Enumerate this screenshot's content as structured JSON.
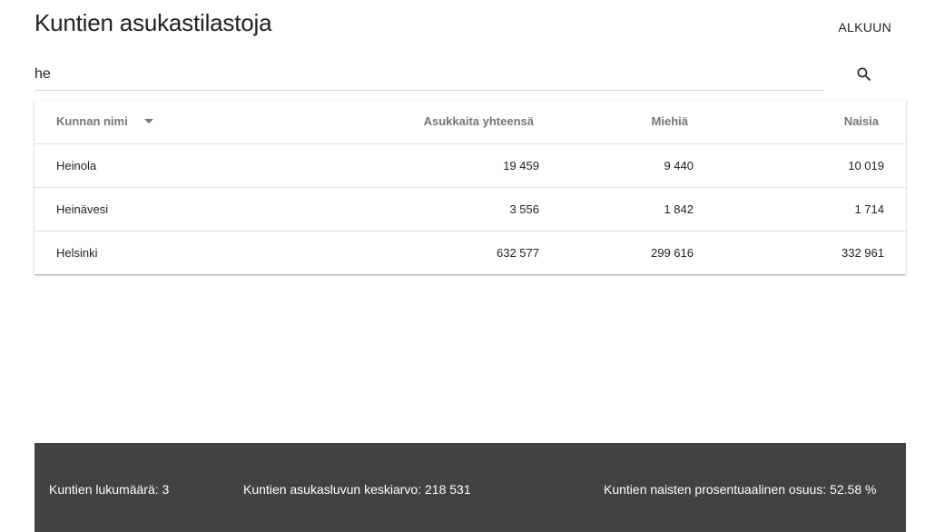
{
  "header": {
    "title": "Kuntien asukastilastoja",
    "home_label": "ALKUUN"
  },
  "search": {
    "value": "he",
    "icon": "search-icon"
  },
  "table": {
    "columns": {
      "name": "Kunnan nimi",
      "total": "Asukkaita yhteensä",
      "men": "Miehiä",
      "women": "Naisia"
    },
    "sort_icon": "arrow-drop-down-icon",
    "rows": [
      {
        "name": "Heinola",
        "total": "19 459",
        "men": "9 440",
        "women": "10 019"
      },
      {
        "name": "Heinävesi",
        "total": "3 556",
        "men": "1 842",
        "women": "1 714"
      },
      {
        "name": "Helsinki",
        "total": "632 577",
        "men": "299 616",
        "women": "332 961"
      }
    ]
  },
  "footer": {
    "count": "Kuntien lukumäärä: 3",
    "average": "Kuntien asukasluvun keskiarvo: 218 531",
    "women_share": "Kuntien naisten prosentuaalinen osuus: 52.58 %",
    "background_color": "#424242"
  }
}
